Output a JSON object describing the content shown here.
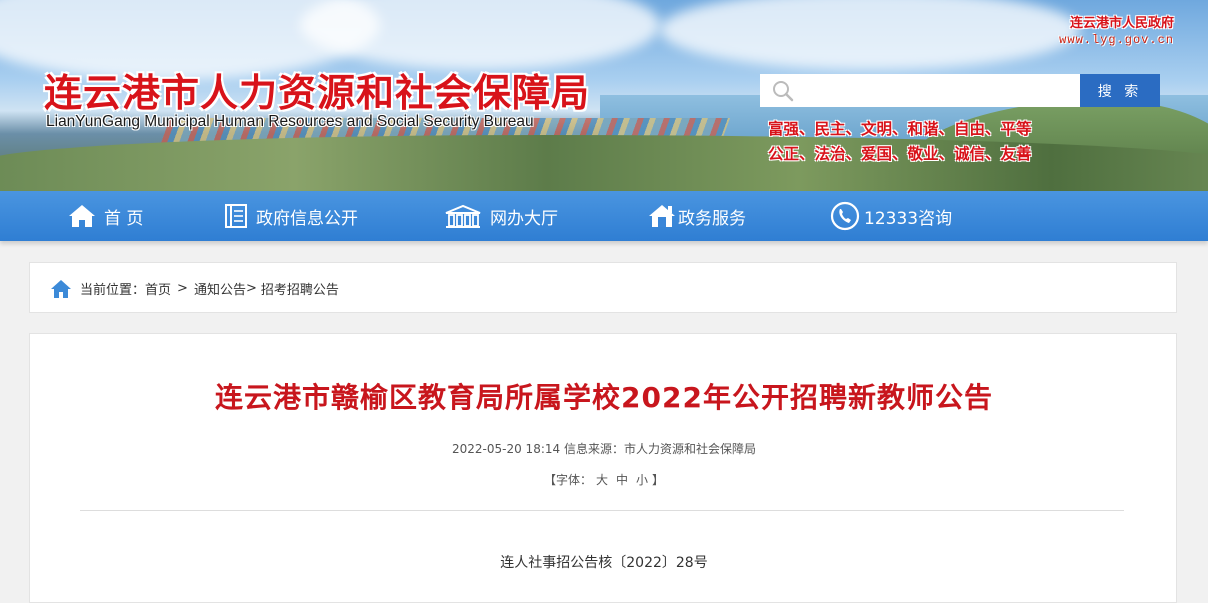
{
  "header": {
    "title": "连云港市人力资源和社会保障局",
    "subtitle": "LianYunGang Municipal Human Resources and Social Security Bureau",
    "gov_link_name": "连云港市人民政府",
    "gov_link_url_text": "www.lyg.gov.cn",
    "search": {
      "placeholder": "",
      "button_label": "搜 索"
    },
    "core_values": [
      "富强、民主、文明、和谐、自由、平等",
      "公正、法治、爱国、敬业、诚信、友善"
    ]
  },
  "nav": {
    "items": [
      {
        "label": "首 页",
        "icon": "home-icon"
      },
      {
        "label": "政府信息公开",
        "icon": "document-icon"
      },
      {
        "label": "网办大厅",
        "icon": "building-icon"
      },
      {
        "label": "政务服务",
        "icon": "house-service-icon"
      },
      {
        "label": "12333咨询",
        "icon": "phone-icon"
      }
    ]
  },
  "breadcrumb": {
    "prefix": "当前位置：",
    "items": [
      "首页",
      "通知公告",
      "招考招聘公告"
    ],
    "sep1": ">",
    "sep2": ">"
  },
  "article": {
    "title": "连云港市赣榆区教育局所属学校2022年公开招聘新教师公告",
    "datetime": "2022-05-20 18:14",
    "source_label": "信息来源：",
    "source": "市人力资源和社会保障局",
    "font_prefix": "【字体：",
    "font_options": [
      "大",
      "中",
      "小"
    ],
    "font_suffix": "】",
    "doc_number": "连人社事招公告核〔2022〕28号"
  },
  "colors": {
    "brand_red": "#d8131a",
    "nav_blue": "#2f7ed3",
    "search_button": "#2b6cc2"
  }
}
